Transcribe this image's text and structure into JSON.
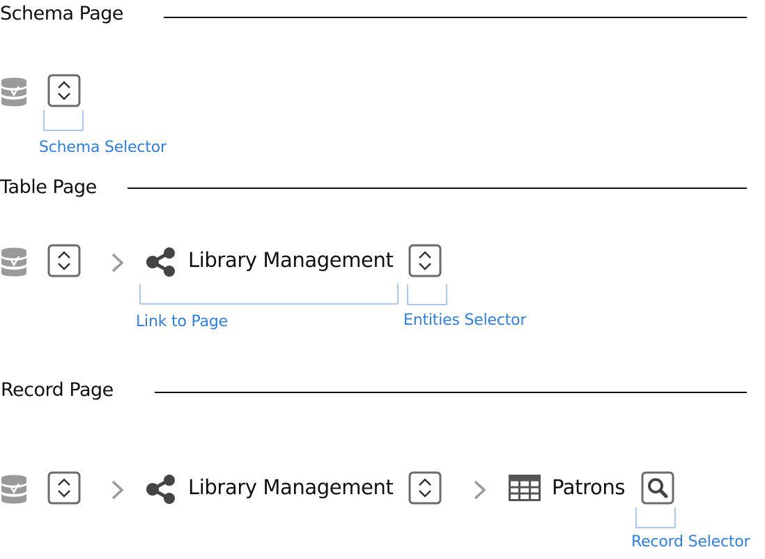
{
  "sections": {
    "schema": {
      "title": "Schema Page",
      "annotations": {
        "schema_selector": "Schema Selector"
      }
    },
    "table": {
      "title": "Table Page",
      "schema_name": "Library Management",
      "annotations": {
        "link_to_page": "Link to Page",
        "entities_selector": "Entities Selector"
      }
    },
    "record": {
      "title": "Record Page",
      "schema_name": "Library Management",
      "table_name": "Patrons",
      "annotations": {
        "record_selector": "Record Selector"
      }
    }
  },
  "colors": {
    "annotation": "#2f7fdc",
    "annotation_bracket": "#a9c8f0",
    "icon_gray": "#6b6b6b",
    "icon_light": "#9a9a9a",
    "text": "#111111"
  },
  "icons": [
    "database-icon",
    "selector-chevrons-icon",
    "chevron-right-icon",
    "share-icon",
    "table-grid-icon",
    "search-icon"
  ]
}
